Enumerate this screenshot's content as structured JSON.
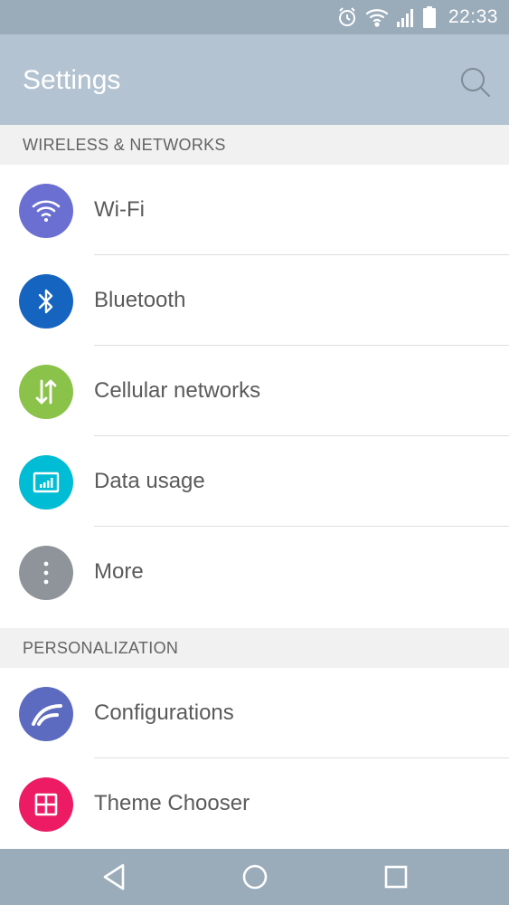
{
  "status_bar": {
    "time": "22:33",
    "icons": [
      "alarm-icon",
      "wifi-icon",
      "signal-icon",
      "battery-icon"
    ]
  },
  "app_bar": {
    "title": "Settings",
    "search_icon": "search-icon"
  },
  "sections": [
    {
      "header": "WIRELESS & NETWORKS",
      "items": [
        {
          "label": "Wi-Fi",
          "icon": "wifi-icon",
          "color": "#6b6fd1"
        },
        {
          "label": "Bluetooth",
          "icon": "bluetooth-icon",
          "color": "#1565c0"
        },
        {
          "label": "Cellular networks",
          "icon": "cellular-arrows-icon",
          "color": "#8bc34a"
        },
        {
          "label": "Data usage",
          "icon": "data-usage-icon",
          "color": "#00bcd4"
        },
        {
          "label": "More",
          "icon": "more-vert-icon",
          "color": "#8e9499"
        }
      ]
    },
    {
      "header": "PERSONALIZATION",
      "items": [
        {
          "label": "Configurations",
          "icon": "configurations-icon",
          "color": "#5c6bc0"
        },
        {
          "label": "Theme Chooser",
          "icon": "theme-chooser-icon",
          "color": "#ec1b63"
        }
      ]
    }
  ],
  "nav_bar": {
    "icons": [
      "back-icon",
      "home-icon",
      "recents-icon"
    ]
  }
}
